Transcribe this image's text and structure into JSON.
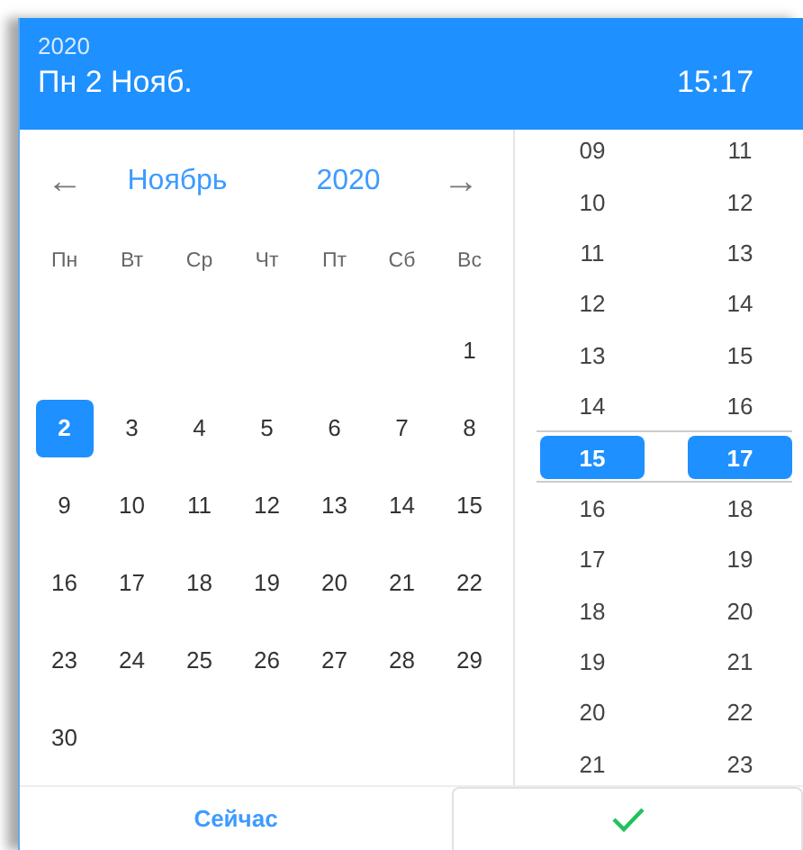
{
  "header": {
    "year": "2020",
    "date": "Пн 2 Нояб.",
    "time": "15:17"
  },
  "nav": {
    "prev": "←",
    "month": "Ноябрь",
    "year": "2020",
    "next": "→"
  },
  "weekdays": [
    "Пн",
    "Вт",
    "Ср",
    "Чт",
    "Пт",
    "Сб",
    "Вс"
  ],
  "weeks": [
    {
      "days": [
        {
          "label": "1",
          "selected": false
        }
      ]
    },
    {
      "days": [
        {
          "label": "2",
          "selected": true
        },
        {
          "label": "3",
          "selected": false
        },
        {
          "label": "4",
          "selected": false
        },
        {
          "label": "5",
          "selected": false
        },
        {
          "label": "6",
          "selected": false
        },
        {
          "label": "7",
          "selected": false
        },
        {
          "label": "8",
          "selected": false
        }
      ]
    },
    {
      "days": [
        {
          "label": "9",
          "selected": false
        },
        {
          "label": "10",
          "selected": false
        },
        {
          "label": "11",
          "selected": false
        },
        {
          "label": "12",
          "selected": false
        },
        {
          "label": "13",
          "selected": false
        },
        {
          "label": "14",
          "selected": false
        },
        {
          "label": "15",
          "selected": false
        }
      ]
    },
    {
      "days": [
        {
          "label": "16",
          "selected": false
        },
        {
          "label": "17",
          "selected": false
        },
        {
          "label": "18",
          "selected": false
        },
        {
          "label": "19",
          "selected": false
        },
        {
          "label": "20",
          "selected": false
        },
        {
          "label": "21",
          "selected": false
        },
        {
          "label": "22",
          "selected": false
        }
      ]
    },
    {
      "days": [
        {
          "label": "23",
          "selected": false
        },
        {
          "label": "24",
          "selected": false
        },
        {
          "label": "25",
          "selected": false
        },
        {
          "label": "26",
          "selected": false
        },
        {
          "label": "27",
          "selected": false
        },
        {
          "label": "28",
          "selected": false
        },
        {
          "label": "29",
          "selected": false
        }
      ]
    },
    {
      "days": [
        {
          "label": "30",
          "selected": false
        }
      ]
    }
  ],
  "hours": [
    {
      "label": "09",
      "selected": false
    },
    {
      "label": "10",
      "selected": false
    },
    {
      "label": "11",
      "selected": false
    },
    {
      "label": "12",
      "selected": false
    },
    {
      "label": "13",
      "selected": false
    },
    {
      "label": "14",
      "selected": false
    },
    {
      "label": "15",
      "selected": true
    },
    {
      "label": "16",
      "selected": false
    },
    {
      "label": "17",
      "selected": false
    },
    {
      "label": "18",
      "selected": false
    },
    {
      "label": "19",
      "selected": false
    },
    {
      "label": "20",
      "selected": false
    },
    {
      "label": "21",
      "selected": false
    }
  ],
  "minutes": [
    {
      "label": "11",
      "selected": false
    },
    {
      "label": "12",
      "selected": false
    },
    {
      "label": "13",
      "selected": false
    },
    {
      "label": "14",
      "selected": false
    },
    {
      "label": "15",
      "selected": false
    },
    {
      "label": "16",
      "selected": false
    },
    {
      "label": "17",
      "selected": true
    },
    {
      "label": "18",
      "selected": false
    },
    {
      "label": "19",
      "selected": false
    },
    {
      "label": "20",
      "selected": false
    },
    {
      "label": "21",
      "selected": false
    },
    {
      "label": "22",
      "selected": false
    },
    {
      "label": "23",
      "selected": false
    }
  ],
  "footer": {
    "now_button": "Сейчас"
  }
}
